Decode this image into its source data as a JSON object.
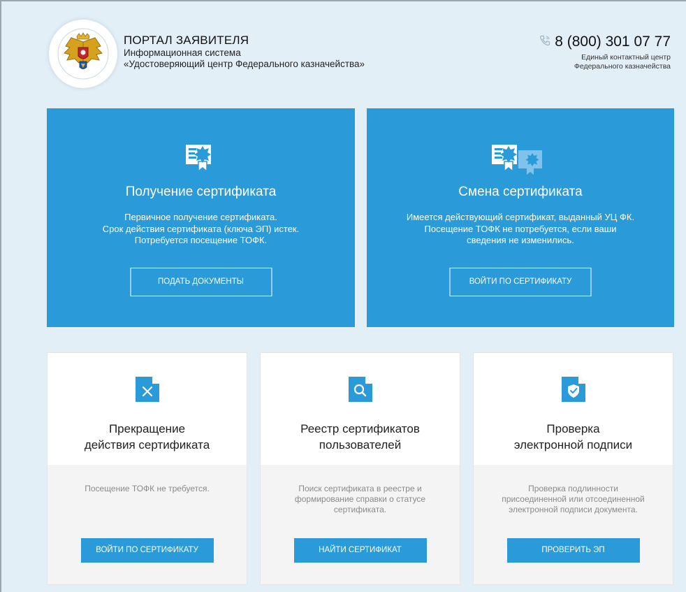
{
  "header": {
    "title": "ПОРТАЛ ЗАЯВИТЕЛЯ",
    "subtitle_line1": "Информационная система",
    "subtitle_line2": "«Удостоверяющий центр Федерального казначейства»",
    "phone": "8 (800) 301 07 77",
    "contact_line1": "Единый контактный центр",
    "contact_line2": "Федерального казначейства",
    "logo_icon": "coat-of-arms-icon",
    "phone_icon": "phone-icon"
  },
  "big_cards": [
    {
      "icon": "certificate-icon",
      "title": "Получение сертификата",
      "desc_line1": "Первичное получение сертификата.",
      "desc_line2": "Срок действия сертификата (ключа ЭП) истек.",
      "desc_line3": "Потребуется посещение ТОФК.",
      "button": "ПОДАТЬ ДОКУМЕНТЫ"
    },
    {
      "icon": "certificate-change-icon",
      "title": "Смена сертификата",
      "desc_line1": "Имеется действующий сертификат, выданный УЦ ФК.",
      "desc_line2": "Посещение ТОФК не потребуется, если ваши",
      "desc_line3": "сведения не изменились.",
      "button": "ВОЙТИ ПО СЕРТИФИКАТУ"
    }
  ],
  "small_cards": [
    {
      "icon": "document-revoke-icon",
      "title_line1": "Прекращение",
      "title_line2": "действия сертификата",
      "desc_line1": "Посещение ТОФК не требуется.",
      "desc_line2": "",
      "desc_line3": "",
      "button": "ВОЙТИ ПО СЕРТИФИКАТУ"
    },
    {
      "icon": "document-search-icon",
      "title_line1": "Реестр сертификатов",
      "title_line2": "пользователей",
      "desc_line1": "Поиск сертификата в реестре и",
      "desc_line2": "формирование справки о статусе",
      "desc_line3": "сертификата.",
      "button": "НАЙТИ СЕРТИФИКАТ"
    },
    {
      "icon": "document-verified-icon",
      "title_line1": "Проверка",
      "title_line2": "электронной подписи",
      "desc_line1": "Проверка подлинности",
      "desc_line2": "присоединенной или отсоединенной",
      "desc_line3": "электронной подписи документа.",
      "button": "ПРОВЕРИТЬ ЭП"
    }
  ],
  "colors": {
    "background": "#e3eff7",
    "accent": "#2a9ad8",
    "card_bottom": "#f4f4f4"
  }
}
